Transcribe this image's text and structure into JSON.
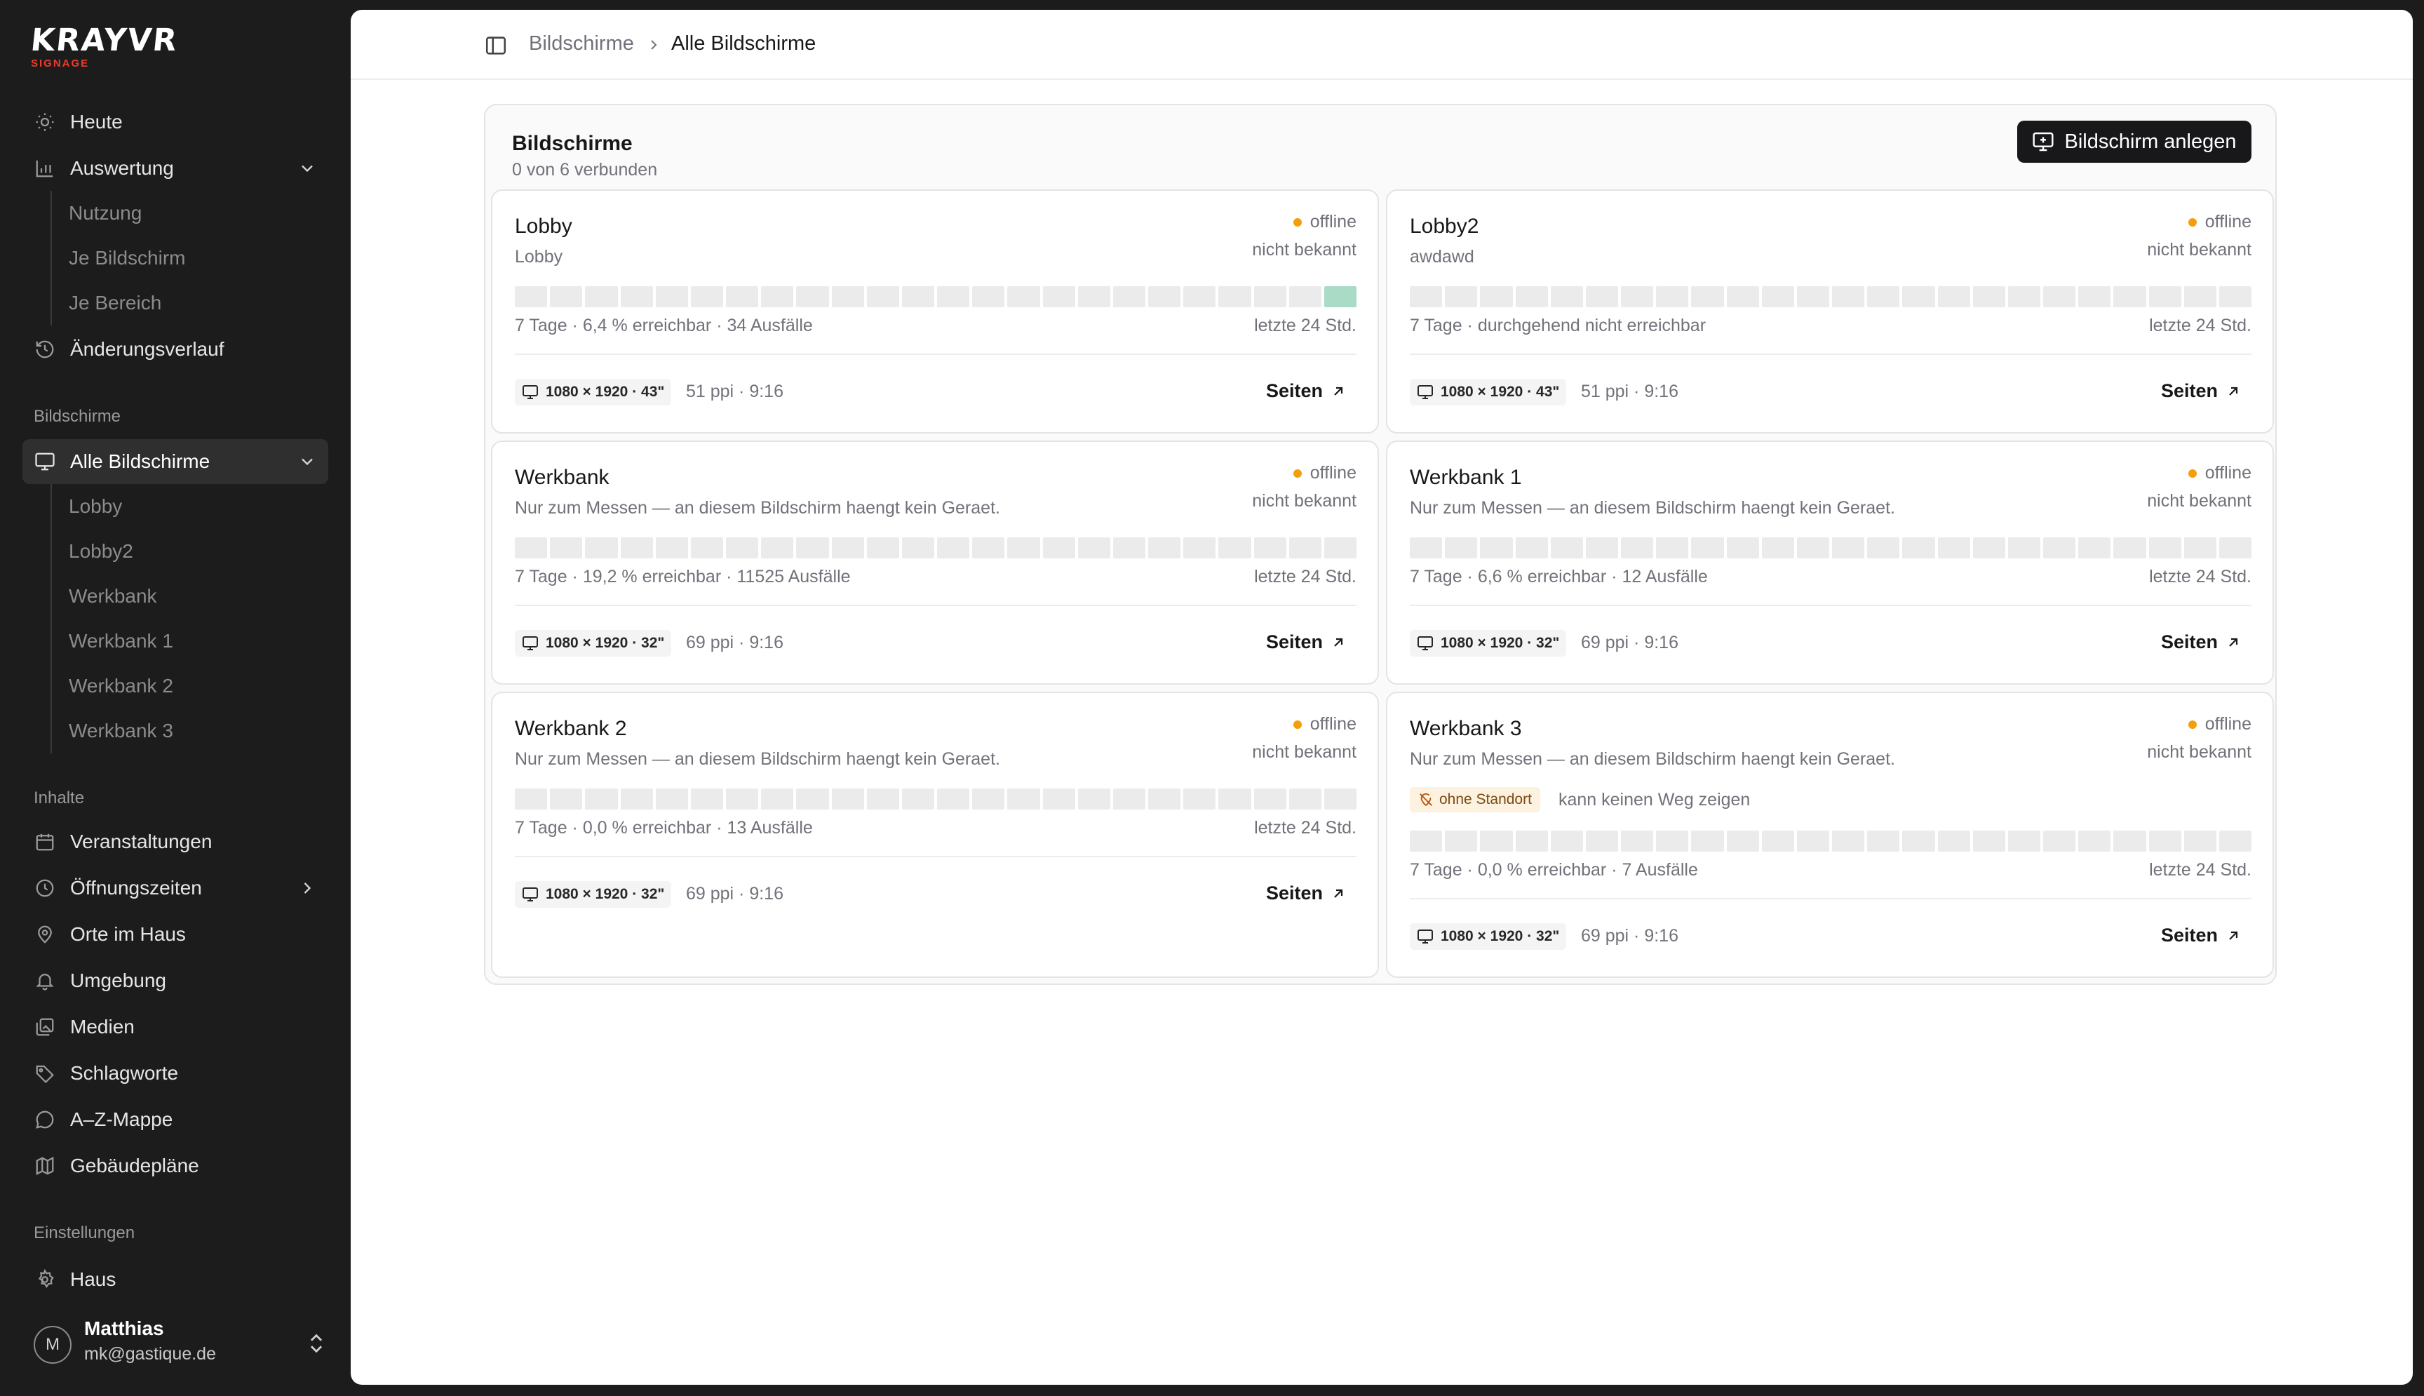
{
  "brand": {
    "name": "KRAYVR",
    "tagline": "SIGNAGE",
    "accent": "#ef3b2c"
  },
  "nav": {
    "heute": "Heute",
    "auswertung": "Auswertung",
    "auswertung_items": [
      "Nutzung",
      "Je Bildschirm",
      "Je Bereich"
    ],
    "aenderungsverlauf": "Änderungsverlauf",
    "section_bildschirme": "Bildschirme",
    "alle_bildschirme": "Alle Bildschirme",
    "bildschirm_items": [
      "Lobby",
      "Lobby2",
      "Werkbank",
      "Werkbank 1",
      "Werkbank 2",
      "Werkbank 3"
    ],
    "section_inhalte": "Inhalte",
    "inhalte": [
      "Veranstaltungen",
      "Öffnungszeiten",
      "Orte im Haus",
      "Umgebung",
      "Medien",
      "Schlagworte",
      "A–Z-Mappe",
      "Gebäudepläne"
    ],
    "section_einstellungen": "Einstellungen",
    "haus": "Haus"
  },
  "user": {
    "initial": "M",
    "name": "Matthias",
    "email": "mk@gastique.de"
  },
  "breadcrumb": {
    "parent": "Bildschirme",
    "current": "Alle Bildschirme"
  },
  "screens_panel": {
    "title": "Bildschirme",
    "subtitle": "0 von 6 verbunden",
    "create_button": "Bildschirm anlegen"
  },
  "screens": [
    {
      "name": "Lobby",
      "description": "Lobby",
      "status": "offline",
      "last_seen": "nicht bekannt",
      "uptime_slots": [
        0,
        0,
        0,
        0,
        0,
        0,
        0,
        0,
        0,
        0,
        0,
        0,
        0,
        0,
        0,
        0,
        0,
        0,
        0,
        0,
        0,
        0,
        0,
        1
      ],
      "stats": "7 Tage · 6,4 % erreichbar · 34 Ausfälle",
      "period": "letzte 24 Std.",
      "spec": "1080 × 1920 · 43\"",
      "spec_extra": "51 ppi · 9:16",
      "pages_label": "Seiten"
    },
    {
      "name": "Lobby2",
      "description": "awdawd",
      "status": "offline",
      "last_seen": "nicht bekannt",
      "uptime_slots": [
        0,
        0,
        0,
        0,
        0,
        0,
        0,
        0,
        0,
        0,
        0,
        0,
        0,
        0,
        0,
        0,
        0,
        0,
        0,
        0,
        0,
        0,
        0,
        0
      ],
      "stats": "7 Tage · durchgehend nicht erreichbar",
      "period": "letzte 24 Std.",
      "spec": "1080 × 1920 · 43\"",
      "spec_extra": "51 ppi · 9:16",
      "pages_label": "Seiten"
    },
    {
      "name": "Werkbank",
      "description": "Nur zum Messen — an diesem Bildschirm haengt kein Geraet.",
      "status": "offline",
      "last_seen": "nicht bekannt",
      "uptime_slots": [
        0,
        0,
        0,
        0,
        0,
        0,
        0,
        0,
        0,
        0,
        0,
        0,
        0,
        0,
        0,
        0,
        0,
        0,
        0,
        0,
        0,
        0,
        0,
        0
      ],
      "stats": "7 Tage · 19,2 % erreichbar · 11525 Ausfälle",
      "period": "letzte 24 Std.",
      "spec": "1080 × 1920 · 32\"",
      "spec_extra": "69 ppi · 9:16",
      "pages_label": "Seiten"
    },
    {
      "name": "Werkbank 1",
      "description": "Nur zum Messen — an diesem Bildschirm haengt kein Geraet.",
      "status": "offline",
      "last_seen": "nicht bekannt",
      "uptime_slots": [
        0,
        0,
        0,
        0,
        0,
        0,
        0,
        0,
        0,
        0,
        0,
        0,
        0,
        0,
        0,
        0,
        0,
        0,
        0,
        0,
        0,
        0,
        0,
        0
      ],
      "stats": "7 Tage · 6,6 % erreichbar · 12 Ausfälle",
      "period": "letzte 24 Std.",
      "spec": "1080 × 1920 · 32\"",
      "spec_extra": "69 ppi · 9:16",
      "pages_label": "Seiten"
    },
    {
      "name": "Werkbank 2",
      "description": "Nur zum Messen — an diesem Bildschirm haengt kein Geraet.",
      "status": "offline",
      "last_seen": "nicht bekannt",
      "uptime_slots": [
        0,
        0,
        0,
        0,
        0,
        0,
        0,
        0,
        0,
        0,
        0,
        0,
        0,
        0,
        0,
        0,
        0,
        0,
        0,
        0,
        0,
        0,
        0,
        0
      ],
      "stats": "7 Tage · 0,0 % erreichbar · 13 Ausfälle",
      "period": "letzte 24 Std.",
      "spec": "1080 × 1920 · 32\"",
      "spec_extra": "69 ppi · 9:16",
      "pages_label": "Seiten"
    },
    {
      "name": "Werkbank 3",
      "description": "Nur zum Messen — an diesem Bildschirm haengt kein Geraet.",
      "status": "offline",
      "last_seen": "nicht bekannt",
      "warning_badge": "ohne Standort",
      "warning_text": "kann keinen Weg zeigen",
      "uptime_slots": [
        0,
        0,
        0,
        0,
        0,
        0,
        0,
        0,
        0,
        0,
        0,
        0,
        0,
        0,
        0,
        0,
        0,
        0,
        0,
        0,
        0,
        0,
        0,
        0
      ],
      "stats": "7 Tage · 0,0 % erreichbar · 7 Ausfälle",
      "period": "letzte 24 Std.",
      "spec": "1080 × 1920 · 32\"",
      "spec_extra": "69 ppi · 9:16",
      "pages_label": "Seiten"
    }
  ],
  "colors": {
    "offline": "#f59e0b",
    "uptime_online": "#a9dbc7",
    "uptime_offline": "#ebebeb"
  }
}
